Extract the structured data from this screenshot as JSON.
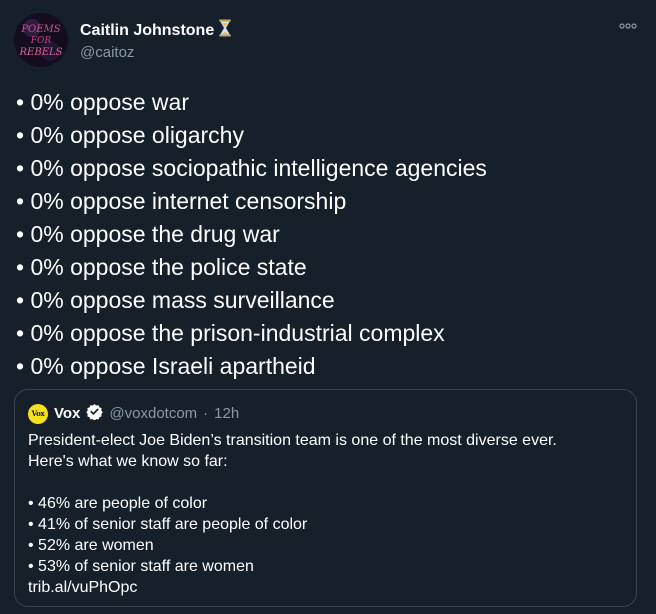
{
  "author": {
    "display_name": "Caitlin Johnstone",
    "handle": "@caitoz",
    "status_emoji": "hourglass-icon",
    "avatar_text": [
      "POEMS",
      "FOR",
      "REBELS"
    ]
  },
  "more_icon": "more-dots-icon",
  "tweet_lines": [
    "• 0% oppose war",
    "• 0% oppose oligarchy",
    "• 0% oppose sociopathic intelligence agencies",
    "• 0% oppose internet censorship",
    "• 0% oppose the drug war",
    "• 0% oppose the police state",
    "• 0% oppose mass surveillance",
    "• 0% oppose the prison-industrial complex",
    "• 0% oppose Israeli apartheid"
  ],
  "quoted": {
    "avatar_text": "Vox",
    "display_name": "Vox",
    "verified_icon": "verified-badge-icon",
    "handle": "@voxdotcom",
    "separator": "·",
    "time": "12h",
    "lines": [
      "President-elect Joe Biden’s transition team is one of the most diverse ever.",
      "Here's what we know so far:",
      "",
      "• 46% are people of color",
      "• 41% of senior staff are people of color",
      "• 52% are women",
      "• 53% of senior staff are women",
      "trib.al/vuPhOpc"
    ]
  },
  "colors": {
    "background": "#15202b",
    "secondary_text": "#8899a6",
    "border": "#38444d",
    "verified_blue": "#1da1f2",
    "vox_yellow": "#f6e01c"
  }
}
